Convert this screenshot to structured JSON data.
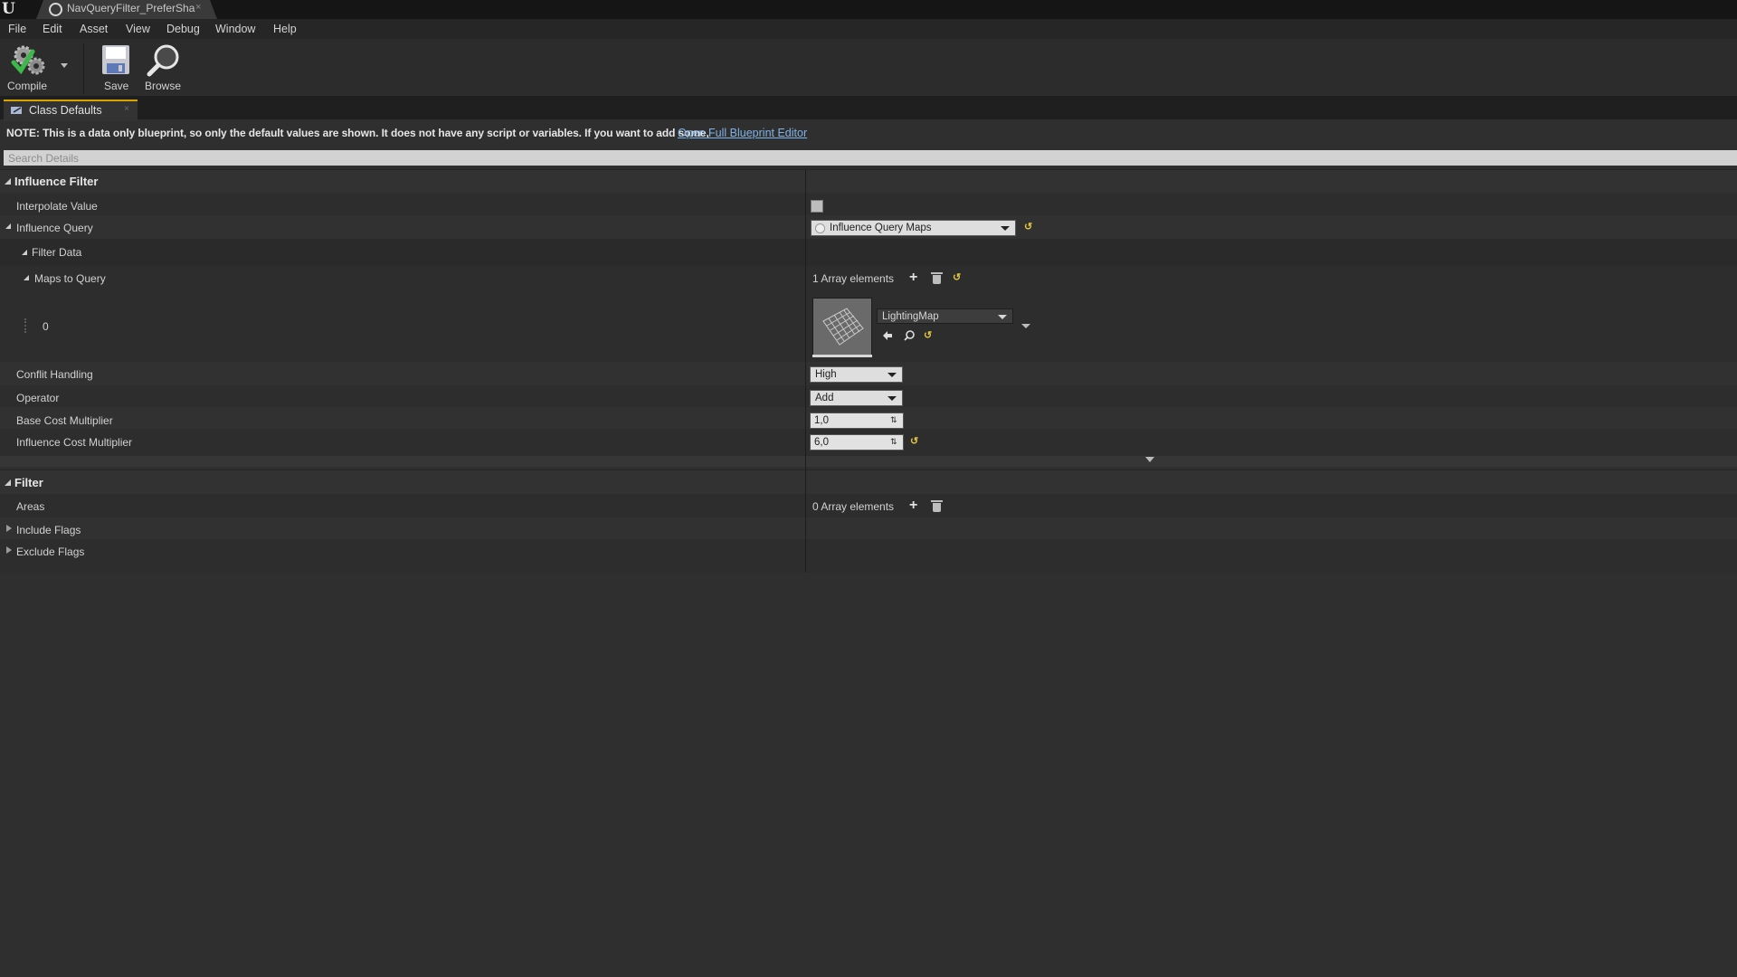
{
  "titlebar": {
    "tab_title": "NavQueryFilter_PreferSha",
    "close_glyph": "×",
    "logo_glyph": "U"
  },
  "menu": {
    "items": [
      "File",
      "Edit",
      "Asset",
      "View",
      "Debug",
      "Window",
      "Help"
    ]
  },
  "toolbar": {
    "compile_label": "Compile",
    "save_label": "Save",
    "browse_label": "Browse"
  },
  "panel": {
    "tab_label": "Class Defaults",
    "close_glyph": "×"
  },
  "note": {
    "text": "NOTE: This is a data only blueprint, so only the default values are shown.  It does not have any script or variables.  If you want to add some,",
    "link": "Open Full Blueprint Editor"
  },
  "search": {
    "placeholder": "Search Details"
  },
  "influence_filter": {
    "category": "Influence Filter",
    "interpolate_value": {
      "label": "Interpolate Value",
      "checked": false
    },
    "influence_query": {
      "label": "Influence Query",
      "value": "Influence Query Maps"
    },
    "filter_data": {
      "label": "Filter Data"
    },
    "maps_to_query": {
      "label": "Maps to Query",
      "count_text": "1 Array elements",
      "index": "0",
      "asset": "LightingMap"
    },
    "conflict_handling": {
      "label": "Conflit Handling",
      "value": "High"
    },
    "operator": {
      "label": "Operator",
      "value": "Add"
    },
    "base_cost_multiplier": {
      "label": "Base Cost Multiplier",
      "value": "1,0"
    },
    "influence_cost_multiplier": {
      "label": "Influence Cost Multiplier",
      "value": "6,0"
    }
  },
  "filter": {
    "category": "Filter",
    "areas": {
      "label": "Areas",
      "count_text": "0 Array elements"
    },
    "include_flags": "Include Flags",
    "exclude_flags": "Exclude Flags"
  },
  "glyphs": {
    "plus": "+",
    "reset": "↺",
    "spin": "⇅"
  },
  "colors": {
    "accent_tab": "#d8a400",
    "link": "#7fb4e8",
    "reset_arrow": "#e0c640",
    "background": "#2f2f2f"
  }
}
